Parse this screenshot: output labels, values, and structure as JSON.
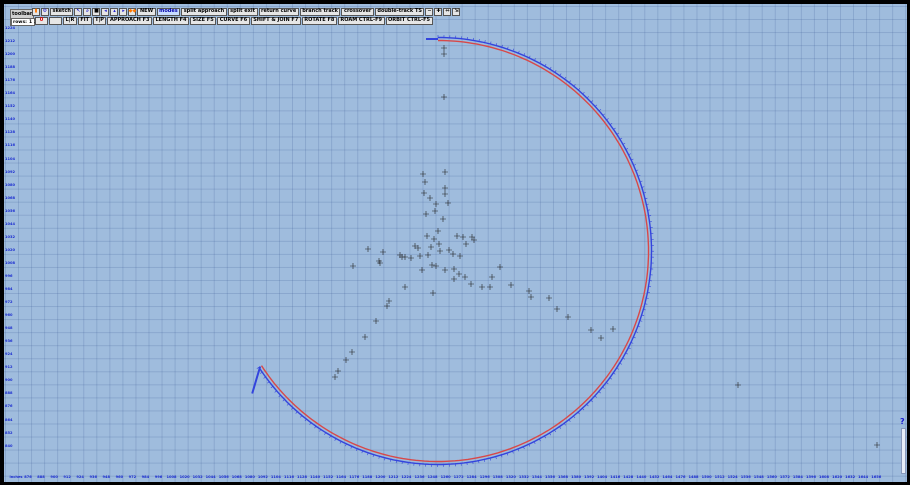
{
  "toolbar": {
    "toolbars_label": "toolbars",
    "rows_label": "rows:",
    "rows_values": [
      "1",
      "2"
    ],
    "row1": {
      "sketch_label": "sketch",
      "new_label": "NEW",
      "mode_label": "modes",
      "split_approach_label": "split approach",
      "split_exit_label": "split exit",
      "return_curve_label": "return curve",
      "branch_track_label": "branch track",
      "crossover_label": "crossover",
      "double_track_label": "double-track TS"
    },
    "row2": {
      "zero_label": "0",
      "blank_label": "",
      "lr_label": "L|R",
      "fit_label": "FIT",
      "tip_label": "T|P",
      "approach_label": "APPROACH F3",
      "length_label": "LENGTH F4",
      "size_label": "SIZE F5",
      "curve_label": "CURVE F6",
      "shift_join_label": "SHIFT & JOIN F7",
      "rotate_label": "ROTATE F8",
      "roam_label": "ROAM CTRL-F9",
      "orbit_label": "ORBIT CTRL-F5"
    }
  },
  "icons": [
    "flag-icon",
    "gear-icon",
    "pointer-icon",
    "magnify-icon",
    "stop-icon",
    "arrow-left-icon",
    "arrow-up-icon",
    "arrow-down-icon",
    "arrow-right-icon",
    "spiral-icon",
    "minus-icon",
    "plus-icon",
    "double-arrow-icon",
    "export-icon"
  ],
  "axes": {
    "x_label": "inches",
    "x_ticks": [
      "876",
      "888",
      "900",
      "912",
      "924",
      "936",
      "948",
      "960",
      "972",
      "984",
      "996",
      "1008",
      "1020",
      "1032",
      "1044",
      "1056",
      "1068",
      "1080",
      "1092",
      "1104",
      "1116",
      "1128",
      "1140",
      "1152",
      "1164",
      "1176",
      "1188",
      "1200",
      "1212",
      "1224",
      "1236",
      "1248",
      "1260",
      "1272",
      "1284",
      "1296",
      "1308",
      "1320",
      "1332",
      "1344",
      "1356",
      "1368",
      "1380",
      "1392",
      "1404",
      "1416",
      "1428",
      "1440",
      "1452",
      "1464",
      "1476",
      "1488",
      "1500",
      "1512",
      "1524",
      "1536",
      "1548",
      "1560",
      "1572",
      "1584",
      "1596",
      "1608",
      "1620",
      "1632",
      "1644",
      "1656"
    ],
    "y_ticks": [
      "1224",
      "1212",
      "1200",
      "1188",
      "1176",
      "1164",
      "1152",
      "1140",
      "1128",
      "1116",
      "1104",
      "1092",
      "1080",
      "1068",
      "1056",
      "1044",
      "1032",
      "1020",
      "1008",
      "996",
      "984",
      "972",
      "960",
      "948",
      "936",
      "924",
      "912",
      "900",
      "888",
      "876",
      "864",
      "852",
      "840"
    ]
  },
  "help_label": "?",
  "colors": {
    "background": "#9fbcdd",
    "track_blue": "#3344dd",
    "track_red": "#d84848",
    "cross": "#222222",
    "axis_text": "#1a2bd0"
  }
}
